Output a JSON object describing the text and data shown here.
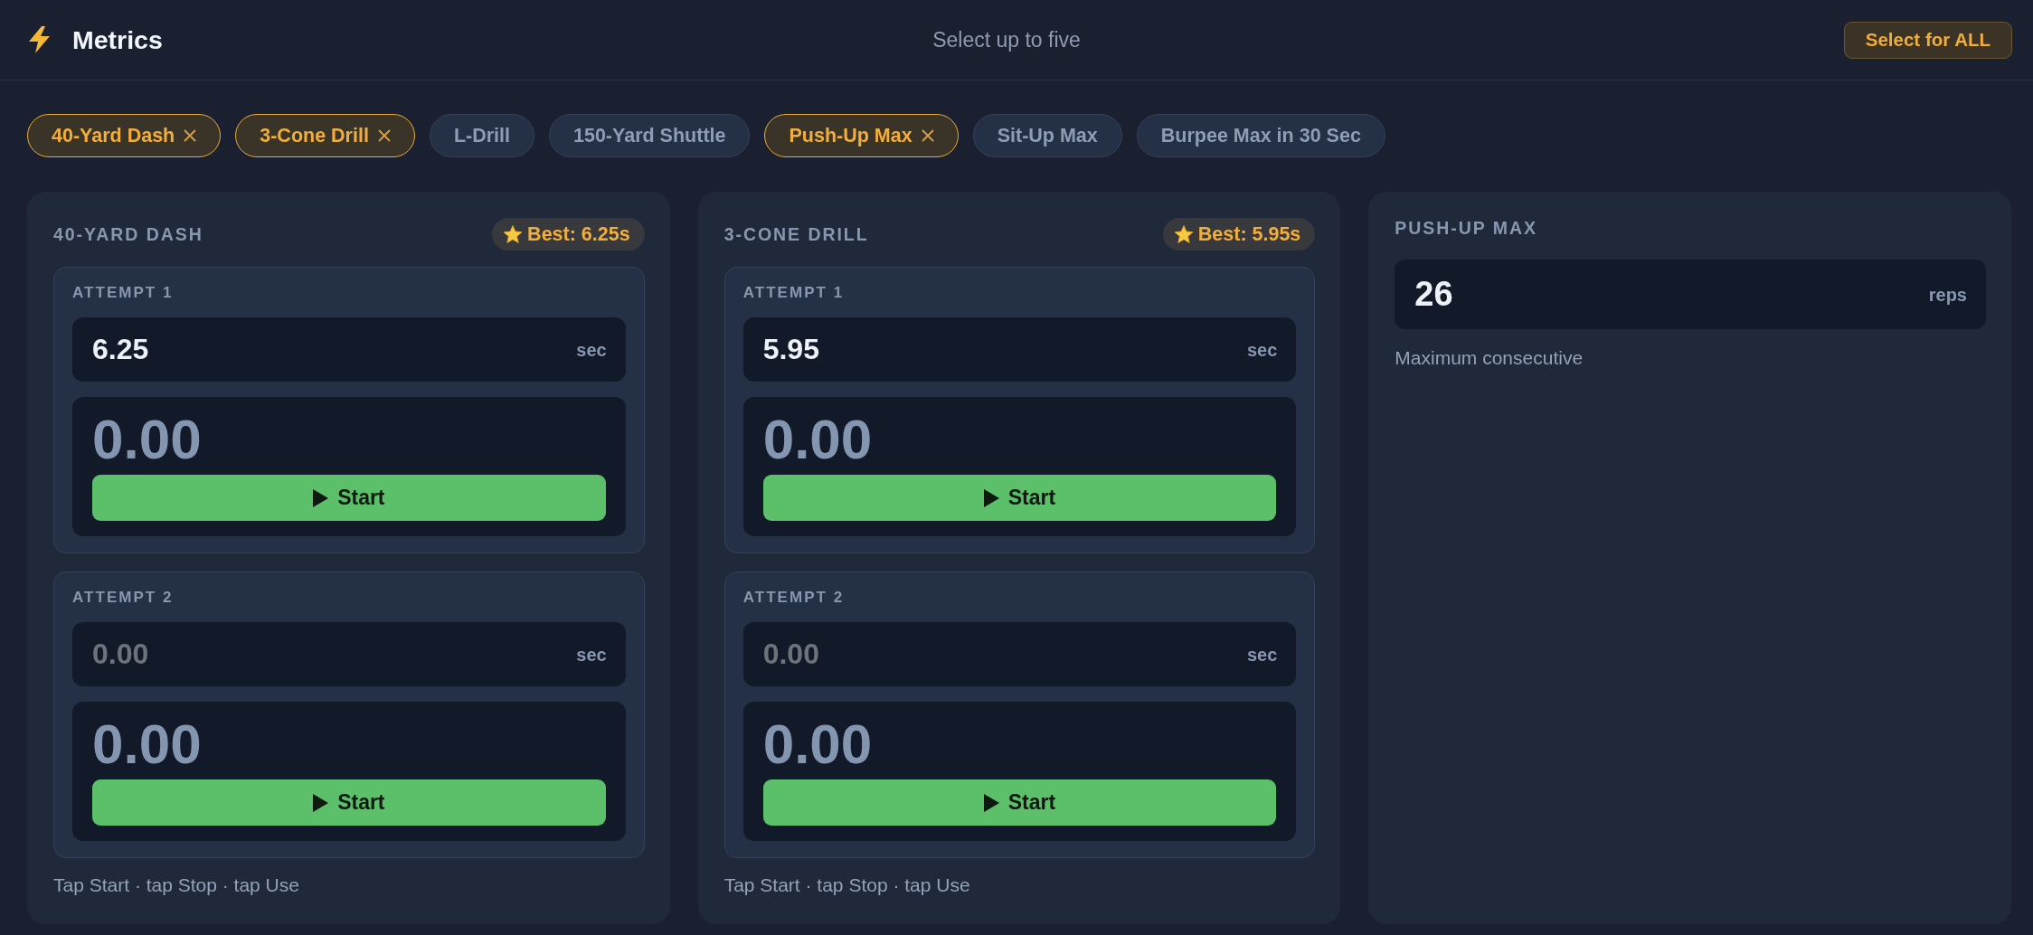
{
  "header": {
    "title": "Metrics",
    "subtitle": "Select up to five",
    "action_button": "Select for ALL"
  },
  "chips": [
    {
      "label": "40-Yard Dash",
      "selected": true
    },
    {
      "label": "3-Cone Drill",
      "selected": true
    },
    {
      "label": "L-Drill",
      "selected": false
    },
    {
      "label": "150-Yard Shuttle",
      "selected": false
    },
    {
      "label": "Push-Up Max",
      "selected": true
    },
    {
      "label": "Sit-Up Max",
      "selected": false
    },
    {
      "label": "Burpee Max in 30 Sec",
      "selected": false
    }
  ],
  "cards": [
    {
      "kind": "timed",
      "title": "40-YARD DASH",
      "best": "Best: 6.25s",
      "attempts": [
        {
          "label": "ATTEMPT 1",
          "value": "6.25",
          "unit": "sec",
          "timer": "0.00",
          "button": "Start"
        },
        {
          "label": "ATTEMPT 2",
          "placeholder": "0.00",
          "unit": "sec",
          "timer": "0.00",
          "button": "Start"
        }
      ],
      "hint": "Tap Start · tap Stop · tap Use"
    },
    {
      "kind": "timed",
      "title": "3-CONE DRILL",
      "best": "Best: 5.95s",
      "attempts": [
        {
          "label": "ATTEMPT 1",
          "value": "5.95",
          "unit": "sec",
          "timer": "0.00",
          "button": "Start"
        },
        {
          "label": "ATTEMPT 2",
          "placeholder": "0.00",
          "unit": "sec",
          "timer": "0.00",
          "button": "Start"
        }
      ],
      "hint": "Tap Start · tap Stop · tap Use"
    },
    {
      "kind": "count",
      "title": "PUSH-UP MAX",
      "value": "26",
      "unit": "reps",
      "hint": "Maximum consecutive"
    }
  ]
}
